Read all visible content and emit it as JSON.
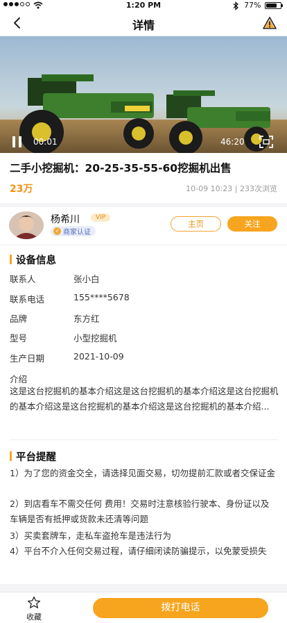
{
  "status_bar": {
    "time": "1:20 PM",
    "battery_text": "77%",
    "battery_level": 0.77,
    "bluetooth_icon": "bluetooth-icon"
  },
  "nav": {
    "title": "详情",
    "back_icon": "chevron-left-icon",
    "report_icon": "warning-triangle-icon"
  },
  "video": {
    "current_time": "00:01",
    "duration": "46:20",
    "play_icon": "pause-icon",
    "fullscreen_icon": "fullscreen-icon"
  },
  "listing": {
    "title": "二手小挖掘机：20-25-35-55-60挖掘机出售",
    "price": "23万",
    "meta": "10-09 10:23 | 233次浏览"
  },
  "seller": {
    "name": "杨希川",
    "vip_label": "VIP",
    "cert_label": "商家认证",
    "home_button": "主页",
    "follow_button": "关注"
  },
  "equipment": {
    "section_title": "设备信息",
    "rows": [
      {
        "label": "联系人",
        "value": "张小白"
      },
      {
        "label": "联系电话",
        "value": "155****5678"
      },
      {
        "label": "品牌",
        "value": "东方红"
      },
      {
        "label": "型号",
        "value": "小型挖掘机"
      },
      {
        "label": "生产日期",
        "value": "2021-10-09"
      }
    ],
    "intro_label": "介绍",
    "intro_text": "这是这台挖掘机的基本介绍这是这台挖掘机的基本介绍这是这台挖掘机的基本介绍这是这台挖掘机的基本介绍这是这台挖掘机的基本介绍..."
  },
  "reminder": {
    "section_title": "平台提醒",
    "items": [
      "1）为了您的资金交全，请选择见面交易，切勿提前汇款或者交保证金",
      "2）到店看车不需交任何 费用！交易时注意核验行驶本、身份证以及车辆是否有抵押或货款未还清等问题",
      "3）买卖套牌车，走私车盗抢车是违法行为",
      "4）平台不介入任何交易过程，请仔细闭读防骗提示，以免蒙受损失"
    ]
  },
  "bottom": {
    "favorite_label": "收藏",
    "call_button": "拨打电话"
  },
  "colors": {
    "accent": "#f7a41e",
    "price": "#f5900f"
  }
}
